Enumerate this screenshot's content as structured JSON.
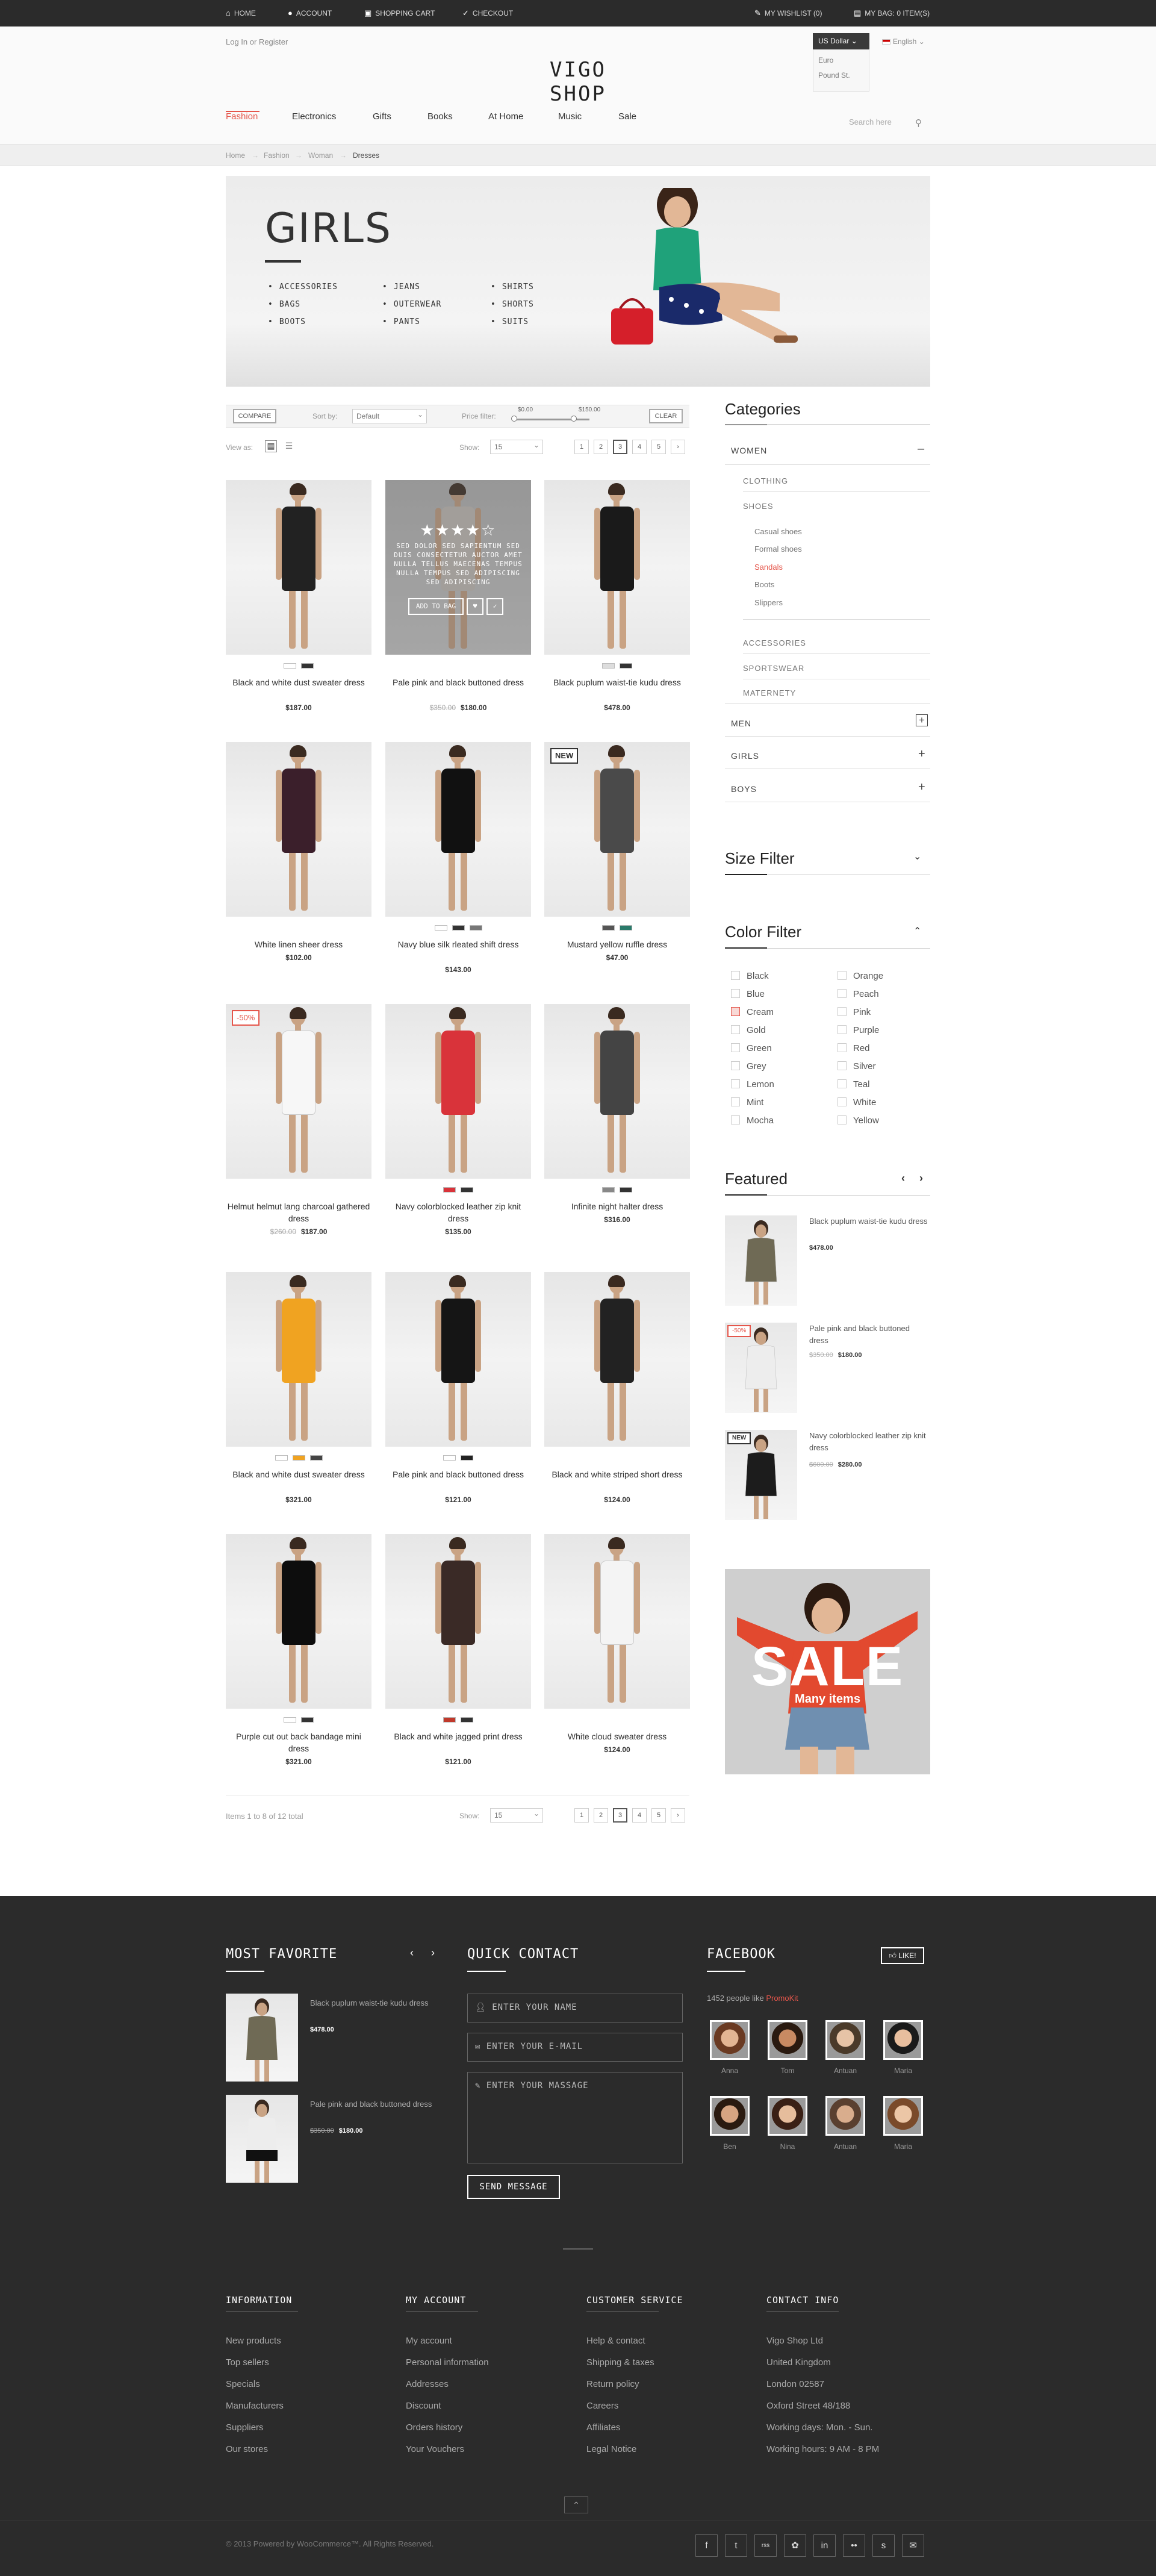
{
  "topbar": {
    "home": "Home",
    "account": "Account",
    "cart": "Shopping cart",
    "checkout": "Checkout",
    "wishlist": "My wishlist (0)",
    "bag": "My bag: 0 item(s)"
  },
  "header": {
    "login": "Log In or Register",
    "logo": "VIGO SHOP",
    "currency_selected": "US Dollar",
    "currency_options": [
      "Euro",
      "Pound St."
    ],
    "language": "English",
    "search_placeholder": "Search here"
  },
  "nav": [
    "Fashion",
    "Electronics",
    "Gifts",
    "Books",
    "At Home",
    "Music",
    "Sale"
  ],
  "breadcrumb": [
    "Home",
    "Fashion",
    "Woman",
    "Dresses"
  ],
  "banner": {
    "title": "GIRLS",
    "col1": [
      "ACCESSORIES",
      "BAGS",
      "BOOTS"
    ],
    "col2": [
      "JEANS",
      "OUTERWEAR",
      "PANTS"
    ],
    "col3": [
      "SHIRTS",
      "SHORTS",
      "SUITS"
    ]
  },
  "toolbar": {
    "compare": "COMPARE",
    "sort_label": "Sort by:",
    "sort_value": "Default",
    "price_label": "Price filter:",
    "price_min": "$0.00",
    "price_max": "$150.00",
    "clear": "CLEAR",
    "view_label": "View as:",
    "show_label": "Show:",
    "show_value": "15",
    "pages": [
      "1",
      "2",
      "3",
      "4",
      "5",
      "›"
    ],
    "current_page": "3",
    "items_total": "Items 1 to 8 of 12 total"
  },
  "products": [
    {
      "name": "Black and white dust sweater dress",
      "price": "$187.00",
      "old": "",
      "tag": "",
      "dress": "#222",
      "swatches": [
        "#fff",
        "#333"
      ]
    },
    {
      "name": "Pale pink and black buttoned dress",
      "price": "$180.00",
      "old": "$350.00",
      "tag": "",
      "dress": "#c9c4bd",
      "swatches": []
    },
    {
      "name": "Black puplum waist-tie kudu dress",
      "price": "$478.00",
      "old": "",
      "tag": "",
      "dress": "#1a1a1a",
      "swatches": [
        "#ddd",
        "#333"
      ]
    },
    {
      "name": "White linen sheer dress",
      "price": "$102.00",
      "old": "",
      "tag": "",
      "dress": "#3b1f2b",
      "swatches": []
    },
    {
      "name": "Navy blue silk rleated shift dress",
      "price": "$143.00",
      "old": "",
      "tag": "",
      "dress": "#111",
      "swatches": [
        "#fff",
        "#333",
        "#777"
      ]
    },
    {
      "name": "Mustard yellow ruffle dress",
      "price": "$47.00",
      "old": "",
      "tag": "NEW",
      "dress": "#4a4a4a",
      "swatches": [
        "#555",
        "#2a7a6a"
      ]
    },
    {
      "name": "Helmut helmut lang charcoal gathered dress",
      "price": "$187.00",
      "old": "$260.00",
      "tag": "-50%",
      "dress": "#f7f7f7",
      "swatches": []
    },
    {
      "name": "Navy colorblocked leather zip knit dress",
      "price": "$135.00",
      "old": "",
      "tag": "",
      "dress": "#d9333a",
      "swatches": [
        "#d9333a",
        "#333"
      ]
    },
    {
      "name": "Infinite night halter dress",
      "price": "$316.00",
      "old": "",
      "tag": "",
      "dress": "#444",
      "swatches": [
        "#888",
        "#333"
      ]
    },
    {
      "name": "Black and white dust sweater dress",
      "price": "$321.00",
      "old": "",
      "tag": "",
      "dress": "#f0a321",
      "swatches": [
        "#fff",
        "#f0a321",
        "#444"
      ]
    },
    {
      "name": "Pale pink and black buttoned dress",
      "price": "$121.00",
      "old": "",
      "tag": "",
      "dress": "#151515",
      "swatches": [
        "#fff",
        "#222"
      ]
    },
    {
      "name": "Black and white striped short dress",
      "price": "$124.00",
      "old": "",
      "tag": "",
      "dress": "#222",
      "swatches": []
    },
    {
      "name": "Purple cut out back bandage mini dress",
      "price": "$321.00",
      "old": "",
      "tag": "",
      "dress": "#0d0d0d",
      "swatches": [
        "#fff",
        "#333"
      ]
    },
    {
      "name": "Black and white jagged print dress",
      "price": "$121.00",
      "old": "",
      "tag": "",
      "dress": "#3a2a26",
      "swatches": [
        "#c0392b",
        "#333"
      ]
    },
    {
      "name": "White cloud sweater dress",
      "price": "$124.00",
      "old": "",
      "tag": "",
      "dress": "#f4f4f4",
      "swatches": []
    }
  ],
  "hover_card": {
    "text": "SED DOLOR SED SAPIENTUM SED DUIS CONSECTETUR AUCTOR AMET NULLA TELLUS MAECENAS TEMPUS NULLA TEMPUS SED ADIPISCING SED ADIPISCING",
    "add": "ADD TO BAG"
  },
  "categories": {
    "title": "Categories",
    "women": "WOMEN",
    "women_sub": [
      "CLOTHING",
      "SHOES"
    ],
    "shoes_sub": [
      "Casual shoes",
      "Formal shoes",
      "Sandals",
      "Boots",
      "Slippers"
    ],
    "women_sub2": [
      "ACCESSORIES",
      "SPORTSWEAR",
      "MATERNETY"
    ],
    "others": [
      "MEN",
      "GIRLS",
      "BOYS"
    ]
  },
  "size_filter": {
    "title": "Size Filter"
  },
  "color_filter": {
    "title": "Color Filter",
    "left": [
      "Black",
      "Blue",
      "Cream",
      "Gold",
      "Green",
      "Grey",
      "Lemon",
      "Mint",
      "Mocha"
    ],
    "right": [
      "Orange",
      "Peach",
      "Pink",
      "Purple",
      "Red",
      "Silver",
      "Teal",
      "White",
      "Yellow"
    ]
  },
  "featured": {
    "title": "Featured",
    "items": [
      {
        "name": "Black puplum waist-tie kudu dress",
        "price": "$478.00",
        "old": "",
        "tag": ""
      },
      {
        "name": "Pale pink and black buttoned dress",
        "price": "$180.00",
        "old": "$350.00",
        "tag": "-50%"
      },
      {
        "name": "Navy colorblocked leather zip knit dress",
        "price": "$280.00",
        "old": "$600.00",
        "tag": "NEW"
      }
    ]
  },
  "sale_banner": {
    "title": "SALE",
    "sub": "Many items"
  },
  "footer": {
    "favorite_title": "MOST FAVORITE",
    "favorites": [
      {
        "name": "Black puplum waist-tie kudu dress",
        "price": "$478.00",
        "old": ""
      },
      {
        "name": "Pale pink and black buttoned dress",
        "price": "$180.00",
        "old": "$350.00"
      }
    ],
    "contact_title": "QUICK CONTACT",
    "name_ph": "ENTER YOUR NAME",
    "email_ph": "ENTER YOUR E-MAIL",
    "message_ph": "ENTER YOUR MASSAGE",
    "send": "SEND MESSAGE",
    "facebook_title": "FACEBOOK",
    "like": "LIKE!",
    "likes_text": "1452 people like",
    "likes_brand": "PromoKit",
    "people": [
      "Anna",
      "Tom",
      "Antuan",
      "Maria",
      "Ben",
      "Nina",
      "Antuan",
      "Maria"
    ],
    "info_title": "INFORMATION",
    "info": [
      "New products",
      "Top sellers",
      "Specials",
      "Manufacturers",
      "Suppliers",
      "Our stores"
    ],
    "account_title": "MY ACCOUNT",
    "account": [
      "My account",
      "Personal information",
      "Addresses",
      "Discount",
      "Orders history",
      "Your Vouchers"
    ],
    "service_title": "CUSTOMER SERVICE",
    "service": [
      "Help & contact",
      "Shipping & taxes",
      "Return policy",
      "Careers",
      "Affiliates",
      "Legal Notice"
    ],
    "contact_info_title": "CONTACT INFO",
    "contact_info": [
      "Vigo Shop Ltd",
      "United Kingdom",
      "London 02587",
      "Oxford Street 48/188",
      "Working days: Mon. - Sun.",
      "Working hours: 9 AM - 8 PM"
    ],
    "copyright": "© 2013 Powered by WooCommerce™. All Rights Reserved.",
    "socials": [
      "f",
      "t",
      "rss",
      "✿",
      "in",
      "••",
      "s",
      "✉"
    ]
  }
}
